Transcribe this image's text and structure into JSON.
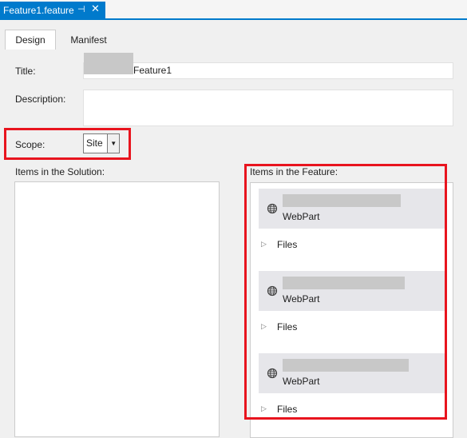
{
  "document_tab": {
    "title": "Feature1.feature",
    "pin_glyph": "⊣",
    "close_glyph": "✕"
  },
  "designer_tabs": [
    {
      "label": "Design"
    },
    {
      "label": "Manifest"
    }
  ],
  "form": {
    "title_label": "Title:",
    "title_value": "Feature1",
    "description_label": "Description:",
    "description_value": "",
    "scope_label": "Scope:",
    "scope_value": "Site",
    "scope_arrow": "▼"
  },
  "solution_section": {
    "label": "Items in the Solution:"
  },
  "feature_section": {
    "label": "Items in the Feature:",
    "items": [
      {
        "type": "WebPart",
        "files_label": "Files",
        "icon": "web-globe-icon"
      },
      {
        "type": "WebPart",
        "files_label": "Files",
        "icon": "web-globe-icon"
      },
      {
        "type": "WebPart",
        "files_label": "Files",
        "icon": "web-globe-icon"
      }
    ]
  },
  "colors": {
    "accent": "#007acc",
    "highlight": "#e8141e",
    "item_bg": "#e6e6ea",
    "redaction": "#c8c8c8"
  }
}
